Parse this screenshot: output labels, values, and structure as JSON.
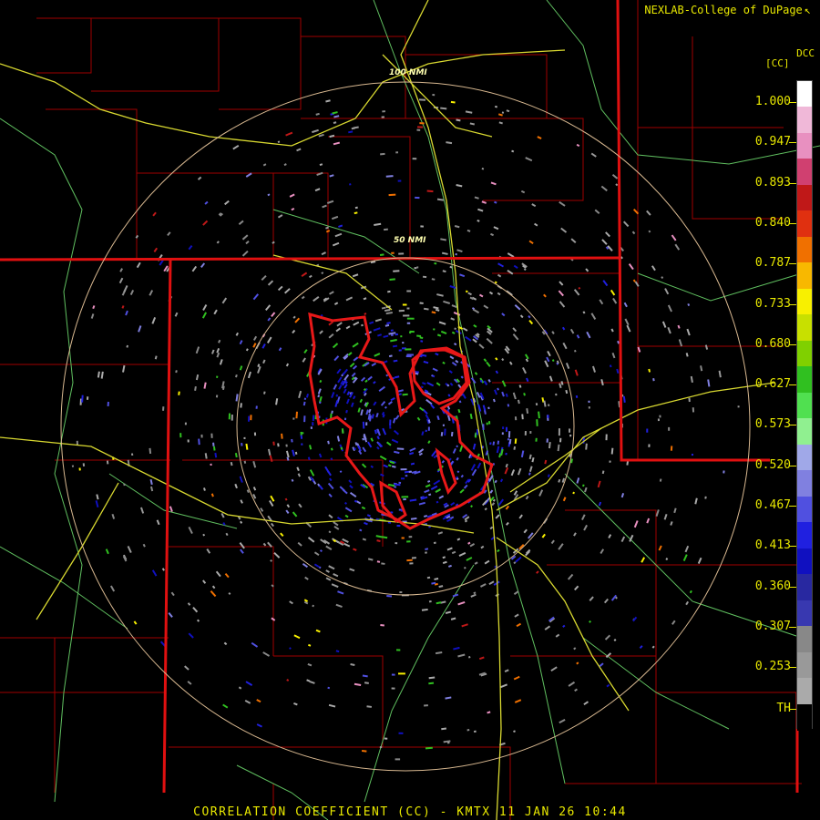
{
  "credit": {
    "text": "NEXLAB-College of DuPage",
    "mark": "↖"
  },
  "legend": {
    "product": "DCC",
    "unit": "[CC]",
    "labels": [
      "1.000",
      "0.947",
      "0.893",
      "0.840",
      "0.787",
      "0.733",
      "0.680",
      "0.627",
      "0.573",
      "0.520",
      "0.467",
      "0.413",
      "0.360",
      "0.307",
      "0.253",
      "TH"
    ],
    "colors": [
      "#ffffff",
      "#f0b8d8",
      "#e890c0",
      "#d04070",
      "#c01818",
      "#e03010",
      "#f07000",
      "#f8b800",
      "#f8f000",
      "#c8e000",
      "#80d000",
      "#30c020",
      "#50e050",
      "#90f090",
      "#a0a8e8",
      "#8080e0",
      "#5050e0",
      "#2020e0",
      "#1010c0",
      "#2828a0",
      "#3838b0",
      "#888888",
      "#999999",
      "#aaaaaa",
      "#000000"
    ]
  },
  "rings": {
    "inner": "50 NMI",
    "outer": "100 NMI"
  },
  "footer": {
    "text": "CORRELATION COEFFICIENT (CC) - KMTX 11 JAN 26 10:44"
  },
  "map_colors": {
    "state_lines": "#e01010",
    "county_lines": "#a00000",
    "roads": "#d8d830",
    "rivers": "#60c060",
    "rings": "#d8b890",
    "outline": "#e81818"
  }
}
